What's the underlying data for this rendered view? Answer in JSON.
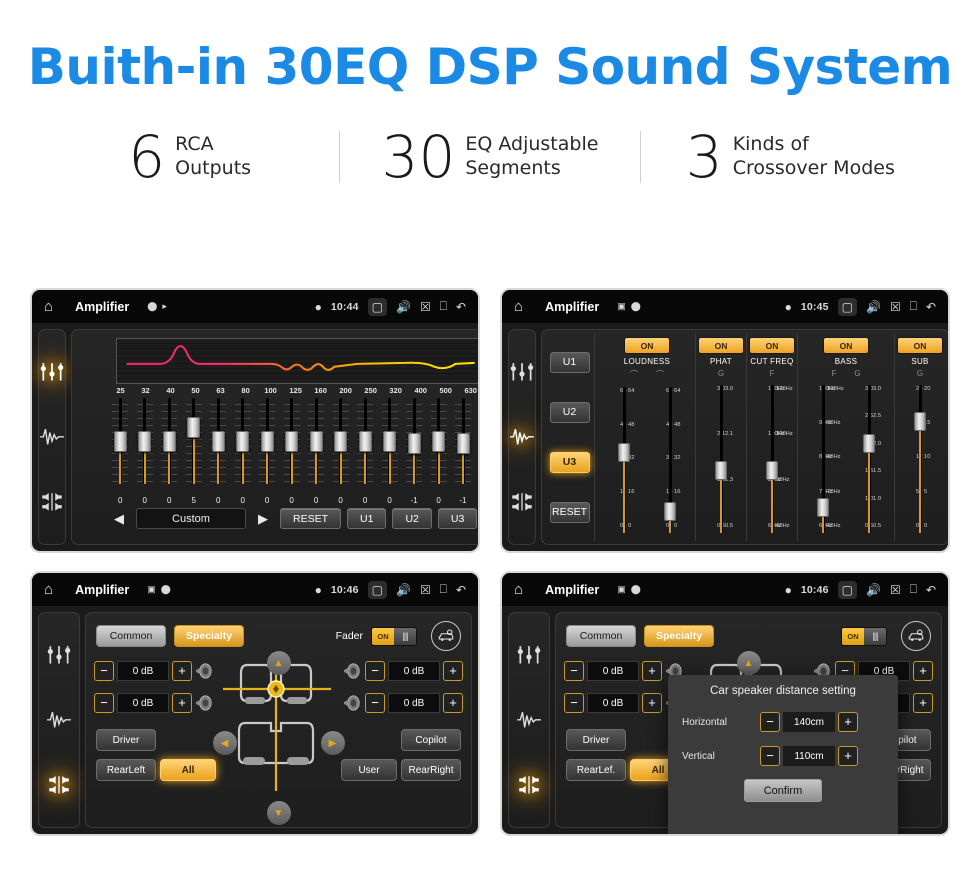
{
  "header": {
    "title": "Buith-in 30EQ DSP Sound System",
    "title_color": "#1a8ae5",
    "stats": [
      {
        "number": "6",
        "line1": "RCA",
        "line2": "Outputs"
      },
      {
        "number": "30",
        "line1": "EQ Adjustable",
        "line2": "Segments"
      },
      {
        "number": "3",
        "line1": "Kinds of",
        "line2": "Crossover Modes"
      }
    ]
  },
  "panel1": {
    "statusbar": {
      "app_title": "Amplifier",
      "time": "10:44"
    },
    "rail": [
      {
        "icon": "eq-sliders-icon",
        "active": true
      },
      {
        "icon": "waveform-icon",
        "active": false
      },
      {
        "icon": "balance-icon",
        "active": false
      }
    ],
    "frequencies": [
      "25",
      "32",
      "40",
      "50",
      "63",
      "80",
      "100",
      "125",
      "160",
      "200",
      "250",
      "320",
      "400",
      "500",
      "630"
    ],
    "values": [
      "0",
      "0",
      "0",
      "5",
      "0",
      "0",
      "0",
      "0",
      "0",
      "0",
      "0",
      "0",
      "-1",
      "0",
      "-1"
    ],
    "preset": "Custom",
    "prev_label": "◀",
    "next_label": "▶",
    "reset_label": "RESET",
    "user_presets": [
      "U1",
      "U2",
      "U3"
    ],
    "expand_label": "»"
  },
  "panel2": {
    "statusbar": {
      "app_title": "Amplifier",
      "time": "10:45"
    },
    "rail": [
      {
        "icon": "eq-sliders-icon",
        "active": false
      },
      {
        "icon": "waveform-icon",
        "active": true
      },
      {
        "icon": "balance-icon",
        "active": false
      }
    ],
    "user_presets": [
      {
        "label": "U1",
        "selected": false
      },
      {
        "label": "U2",
        "selected": false
      },
      {
        "label": "U3",
        "selected": true
      }
    ],
    "reset_label": "RESET",
    "sections": [
      {
        "name": "LOUDNESS",
        "state": "ON",
        "sub": [
          "⌒",
          "⌒"
        ],
        "scales": [
          [
            "64",
            "48",
            "32",
            "16",
            "0"
          ],
          [
            "64",
            "48",
            "32",
            "16",
            "0"
          ]
        ]
      },
      {
        "name": "PHAT",
        "state": "ON",
        "sub": [
          "G"
        ],
        "scales": [
          [
            "3.0",
            "2.1",
            "1.3",
            "0.5"
          ]
        ]
      },
      {
        "name": "CUT FREQ",
        "state": "ON",
        "sub": [
          "F"
        ],
        "scales": [
          [
            "120Hz",
            "100Hz",
            "80Hz",
            "60Hz"
          ]
        ]
      },
      {
        "name": "BASS",
        "state": "ON",
        "sub": [
          "F",
          "G"
        ],
        "scales": [
          [
            "100Hz",
            "90Hz",
            "80Hz",
            "70Hz",
            "60Hz"
          ],
          [
            "3.0",
            "2.5",
            "2.0",
            "1.5",
            "1.0",
            "0.5"
          ]
        ]
      },
      {
        "name": "SUB",
        "state": "ON",
        "sub": [
          "G"
        ],
        "scales": [
          [
            "20",
            "15",
            "10",
            "5",
            "0"
          ]
        ]
      }
    ]
  },
  "panel3": {
    "statusbar": {
      "app_title": "Amplifier",
      "time": "10:46"
    },
    "rail": [
      {
        "icon": "eq-sliders-icon",
        "active": false
      },
      {
        "icon": "waveform-icon",
        "active": false
      },
      {
        "icon": "balance-icon",
        "active": true
      }
    ],
    "tabs": [
      {
        "label": "Common",
        "active": false
      },
      {
        "label": "Specialty",
        "active": true
      }
    ],
    "fader_label": "Fader",
    "fader_state": "ON",
    "car_settings_icon": "car-settings-icon",
    "steppers": [
      {
        "value": "0 dB",
        "minus": "−",
        "plus": "+"
      },
      {
        "value": "0 dB",
        "minus": "−",
        "plus": "+"
      },
      {
        "value": "0 dB",
        "minus": "−",
        "plus": "+"
      },
      {
        "value": "0 dB",
        "minus": "−",
        "plus": "+"
      }
    ],
    "position_buttons": [
      {
        "label": "Driver",
        "selected": false
      },
      {
        "label": "Copilot",
        "selected": false
      },
      {
        "label": "RearLeft",
        "selected": false
      },
      {
        "label": "All",
        "selected": true
      },
      {
        "label": "User",
        "selected": false
      },
      {
        "label": "RearRight",
        "selected": false
      }
    ]
  },
  "panel4": {
    "statusbar": {
      "app_title": "Amplifier",
      "time": "10:46"
    },
    "rail": [
      {
        "icon": "eq-sliders-icon",
        "active": false
      },
      {
        "icon": "waveform-icon",
        "active": false
      },
      {
        "icon": "balance-icon",
        "active": true
      }
    ],
    "tabs": [
      {
        "label": "Common",
        "active": false
      },
      {
        "label": "Specialty",
        "active": true
      }
    ],
    "fader_state": "ON",
    "modal": {
      "title": "Car speaker distance setting",
      "rows": [
        {
          "label": "Horizontal",
          "value": "140cm",
          "minus": "−",
          "plus": "+"
        },
        {
          "label": "Vertical",
          "value": "110cm",
          "minus": "−",
          "plus": "+"
        }
      ],
      "confirm_label": "Confirm"
    },
    "position_buttons": [
      {
        "label": "Driver",
        "selected": false
      },
      {
        "label": "Copilot",
        "selected": false
      },
      {
        "label": "RearLef.",
        "selected": false
      },
      {
        "label": "All",
        "selected": true
      },
      {
        "label": "User",
        "selected": false
      },
      {
        "label": "RearRight",
        "selected": false
      }
    ]
  }
}
